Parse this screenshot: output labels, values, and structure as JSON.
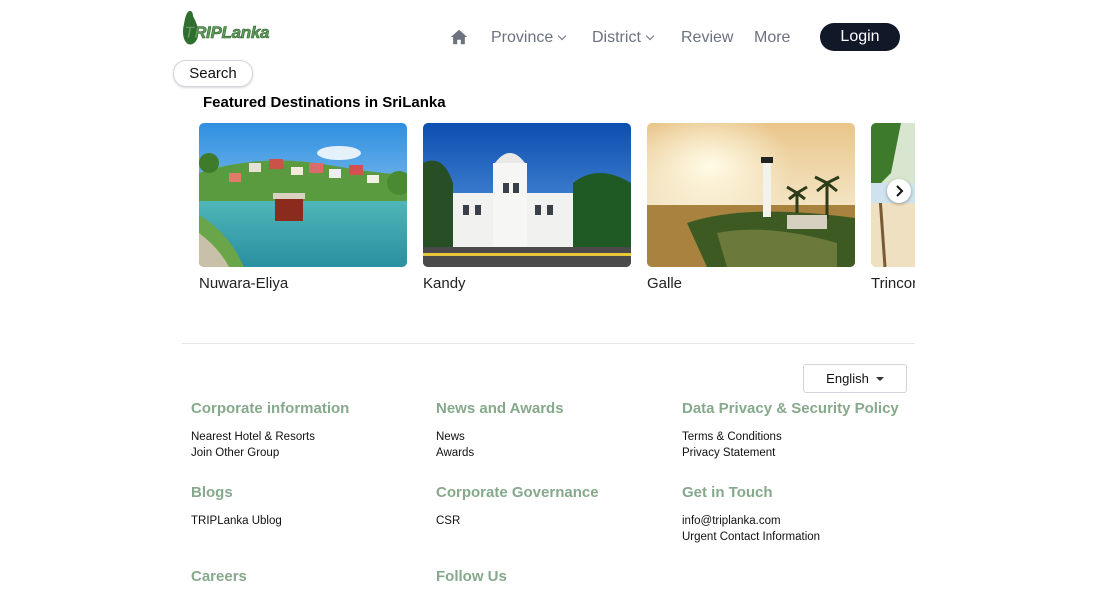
{
  "header": {
    "logo_text": "TRIPLanka",
    "nav": {
      "home_icon": "home-icon",
      "province": "Province",
      "district": "District",
      "review": "Review",
      "more": "More"
    },
    "login_label": "Login",
    "search_label": "Search"
  },
  "featured": {
    "title": "Featured Destinations in SriLanka",
    "destinations": [
      {
        "name": "Nuwara-Eliya"
      },
      {
        "name": "Kandy"
      },
      {
        "name": "Galle"
      },
      {
        "name": "Trincomalee"
      }
    ],
    "next_icon": "chevron-right-icon"
  },
  "footer": {
    "language": "English",
    "sections": [
      {
        "heading": "Corporate information",
        "links": [
          "Nearest Hotel & Resorts",
          "Join Other Group"
        ]
      },
      {
        "heading": "News and Awards",
        "links": [
          "News",
          "Awards"
        ]
      },
      {
        "heading": "Data Privacy & Security Policy",
        "links": [
          "Terms & Conditions",
          "Privacy Statement"
        ]
      },
      {
        "heading": "Blogs",
        "links": [
          "TRIPLanka Ublog"
        ]
      },
      {
        "heading": "Corporate Governance",
        "links": [
          "CSR"
        ]
      },
      {
        "heading": "Get in Touch",
        "links": [
          "info@triplanka.com",
          "Urgent Contact Information"
        ]
      },
      {
        "heading": "Careers",
        "links": []
      },
      {
        "heading": "Follow Us",
        "links": []
      }
    ]
  },
  "colors": {
    "accent_green": "#86a98c",
    "login_bg": "#111827",
    "nav_text": "#6b7280"
  }
}
